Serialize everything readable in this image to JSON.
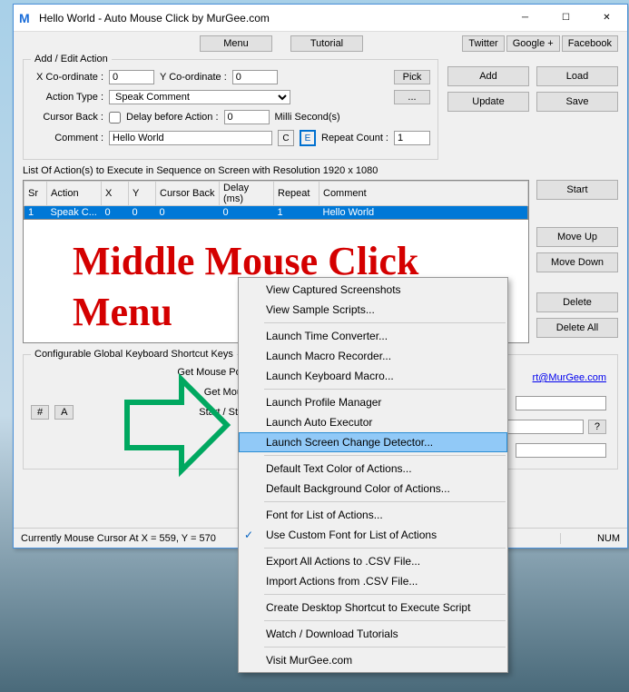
{
  "title": "Hello World - Auto Mouse Click by MurGee.com",
  "topButtons": {
    "menu": "Menu",
    "tutorial": "Tutorial",
    "twitter": "Twitter",
    "google": "Google +",
    "facebook": "Facebook"
  },
  "editAction": {
    "legend": "Add / Edit Action",
    "xLabel": "X Co-ordinate :",
    "xVal": "0",
    "yLabel": "Y Co-ordinate :",
    "yVal": "0",
    "pick": "Pick",
    "actionTypeLabel": "Action Type :",
    "actionType": "Speak Comment",
    "more": "...",
    "cursorBackLabel": "Cursor Back :",
    "delayLabel": "Delay before Action :",
    "delayVal": "0",
    "delayUnit": "Milli Second(s)",
    "commentLabel": "Comment :",
    "commentVal": "Hello World",
    "c": "C",
    "e": "E",
    "repeatLabel": "Repeat Count :",
    "repeatVal": "1"
  },
  "sideButtons": {
    "add": "Add",
    "load": "Load",
    "update": "Update",
    "save": "Save"
  },
  "listLabel": "List Of Action(s) to Execute in Sequence on Screen with Resolution 1920 x 1080",
  "headers": {
    "sr": "Sr",
    "action": "Action",
    "x": "X",
    "y": "Y",
    "cb": "Cursor Back",
    "delay": "Delay (ms)",
    "repeat": "Repeat",
    "comment": "Comment"
  },
  "row": {
    "sr": "1",
    "action": "Speak C...",
    "x": "0",
    "y": "0",
    "cb": "0",
    "delay": "0",
    "repeat": "1",
    "comment": "Hello World"
  },
  "listButtons": {
    "start": "Start",
    "moveup": "Move Up",
    "movedown": "Move Down",
    "delete": "Delete",
    "deleteall": "Delete All"
  },
  "shortcuts": {
    "legend": "Configurable Global Keyboard Shortcut Keys",
    "l1": "Get Mouse Position & Add Action...",
    "l2": "Get Mouse Cursor Position...",
    "l3": "Start / Stop Script Execution...",
    "email": "rt@MurGee.com",
    "q": "?",
    "hash": "#",
    "a": "A"
  },
  "status": {
    "cursor": "Currently Mouse Cursor At X = 559, Y = 570",
    "num": "NUM"
  },
  "overlay": {
    "line1": "Middle Mouse Click",
    "line2": "Menu"
  },
  "menu": {
    "items": [
      "View Captured Screenshots",
      "View Sample Scripts...",
      "---",
      "Launch Time Converter...",
      "Launch Macro Recorder...",
      "Launch Keyboard Macro...",
      "---",
      "Launch Profile Manager",
      "Launch Auto Executor",
      "Launch Screen Change Detector...",
      "---",
      "Default Text Color of Actions...",
      "Default Background Color of Actions...",
      "---",
      "Font for List of Actions...",
      "Use Custom Font for List of Actions",
      "---",
      "Export All Actions to .CSV File...",
      "Import Actions from .CSV File...",
      "---",
      "Create Desktop Shortcut to Execute Script",
      "---",
      "Watch / Download Tutorials",
      "---",
      "Visit MurGee.com"
    ],
    "highlighted": "Launch Screen Change Detector...",
    "checked": "Use Custom Font for List of Actions"
  }
}
